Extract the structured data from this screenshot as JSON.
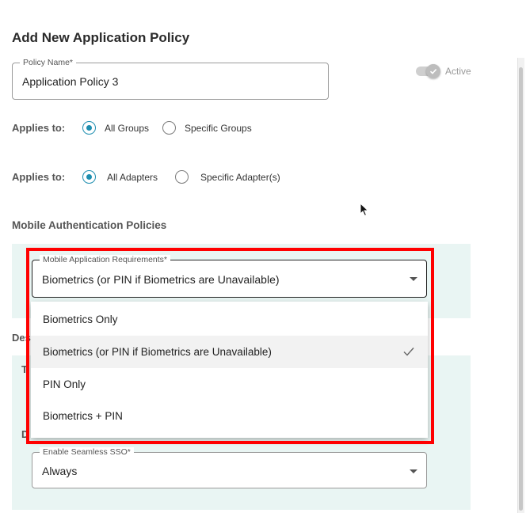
{
  "page": {
    "title": "Add New Application Policy"
  },
  "policy_name": {
    "label": "Policy Name*",
    "value": "Application Policy 3"
  },
  "active_toggle": {
    "label": "Active",
    "on": true
  },
  "groups": {
    "label": "Applies to:",
    "options": [
      {
        "label": "All Groups",
        "checked": true
      },
      {
        "label": "Specific Groups",
        "checked": false
      }
    ]
  },
  "adapters": {
    "label": "Applies to:",
    "options": [
      {
        "label": "All Adapters",
        "checked": true
      },
      {
        "label": "Specific Adapter(s)",
        "checked": false
      }
    ]
  },
  "mobile_auth": {
    "title": "Mobile Authentication Policies",
    "requirements": {
      "label": "Mobile Application Requirements*",
      "value": "Biometrics (or PIN if Biometrics are Unavailable)",
      "options": [
        {
          "label": "Biometrics Only",
          "selected": false
        },
        {
          "label": "Biometrics (or PIN if Biometrics are Unavailable)",
          "selected": true
        },
        {
          "label": "PIN Only",
          "selected": false
        },
        {
          "label": "Biometrics + PIN",
          "selected": false
        }
      ]
    }
  },
  "partial_labels": {
    "des": "Des",
    "t": "T",
    "d": "D"
  },
  "seamless_sso": {
    "label": "Enable Seamless SSO*",
    "value": "Always"
  }
}
